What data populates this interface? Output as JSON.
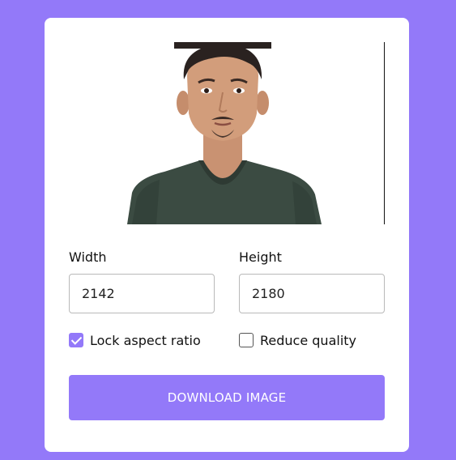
{
  "colors": {
    "background": "#9379f9",
    "accent": "#9379f9",
    "card": "#ffffff"
  },
  "preview": {
    "icon": "person-photo"
  },
  "width_field": {
    "label": "Width",
    "value": "2142"
  },
  "height_field": {
    "label": "Height",
    "value": "2180"
  },
  "options": {
    "lock_aspect_ratio": {
      "label": "Lock aspect ratio",
      "checked": true
    },
    "reduce_quality": {
      "label": "Reduce quality",
      "checked": false
    }
  },
  "download_button": {
    "label": "DOWNLOAD IMAGE"
  }
}
